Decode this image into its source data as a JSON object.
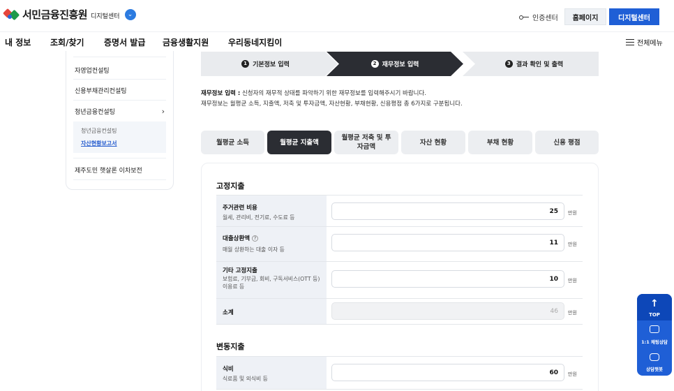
{
  "header": {
    "logo_text": "서민금융진흥원",
    "logo_sub": "디지털센터",
    "cert_label": "인증센터",
    "home_button": "홈페이지",
    "digital_button": "디지털센터"
  },
  "nav": {
    "items": [
      "내 정보",
      "조회/찾기",
      "증명서 발급",
      "금융생활지원",
      "우리동네지킴이"
    ],
    "all_menu": "전체메뉴"
  },
  "sidebar": {
    "items": [
      "자영업컨설팅",
      "신용부채관리컨설팅",
      "청년금융컨설팅",
      "제주도민 햇살론 이차보전"
    ],
    "sub_items": [
      "청년금융컨설팅",
      "자산현황보고서"
    ],
    "chevron": "›"
  },
  "steps": [
    {
      "num": "1",
      "label": "기본정보 입력"
    },
    {
      "num": "2",
      "label": "재무정보 입력"
    },
    {
      "num": "3",
      "label": "결과 확인 및 출력"
    }
  ],
  "description": {
    "bold": "재무정보 입력 :",
    "line1": " 신청자의 재무적 상태를 파악하기 위한 재무정보를 입력해주시기 바랍니다.",
    "line2": "재무정보는 월평균 소득, 지출액, 저축 및 투자금액, 자산현황, 부채현황, 신용평점 총 6가지로 구분됩니다."
  },
  "tabs": [
    {
      "label": "월평균 소득"
    },
    {
      "label": "월평균 지출액"
    },
    {
      "label": "월평균 저축 및 투자금액"
    },
    {
      "label": "자산 현황"
    },
    {
      "label": "부채 현황"
    },
    {
      "label": "신용 평점"
    }
  ],
  "fixed": {
    "title": "고정지출",
    "rows": [
      {
        "title": "주거관련 비용",
        "sub": "월세, 관리비, 전기료, 수도료 등",
        "value": "25",
        "unit": "만원"
      },
      {
        "title": "대출상환액",
        "sub": "매월 상환하는 대출 이자 등",
        "value": "11",
        "unit": "만원"
      },
      {
        "title": "기타 고정지출",
        "sub": "보험료, 기부금, 회비, 구독서비스(OTT 등) 이용료 등",
        "value": "10",
        "unit": "만원"
      },
      {
        "title": "소계",
        "sub": "",
        "value": "46",
        "unit": "만원"
      }
    ]
  },
  "variable": {
    "title": "변동지출",
    "rows": [
      {
        "title": "식비",
        "sub": "식료품 및 외식비 등",
        "value": "60",
        "unit": "만원"
      }
    ]
  },
  "floating": {
    "top": "TOP",
    "chat": "1:1 채팅상담",
    "bot": "상담챗봇"
  },
  "colors": {
    "primary": "#1f5fd6",
    "active_step": "#2b2d33",
    "inactive_step": "#e9ebee"
  }
}
